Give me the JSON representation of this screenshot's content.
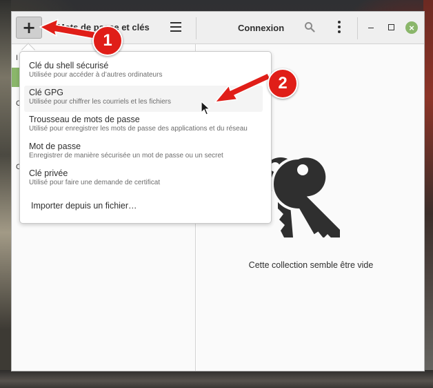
{
  "header": {
    "add_button": "+",
    "app_title": "Mots de passe et clés",
    "connection_title": "Connexion"
  },
  "sidebar": {
    "fragments": [
      "I",
      "C",
      "C"
    ]
  },
  "popover": {
    "items": [
      {
        "title": "Clé du shell sécurisé",
        "subtitle": "Utilisée pour accéder à d’autres ordinateurs"
      },
      {
        "title": "Clé GPG",
        "subtitle": "Utilisée pour chiffrer les courriels et les fichiers"
      },
      {
        "title": "Trousseau de mots de passe",
        "subtitle": "Utilisé pour enregistrer les mots de passe des applications et du réseau"
      },
      {
        "title": "Mot de passe",
        "subtitle": "Enregistrer de manière sécurisée un mot de passe ou un secret"
      },
      {
        "title": "Clé privée",
        "subtitle": "Utilisé pour faire une demande de certificat"
      }
    ],
    "import_label": "Importer depuis un fichier…",
    "hovered_index": 1
  },
  "main": {
    "empty_label": "Cette collection semble être vide"
  },
  "annotations": {
    "badge1": "1",
    "badge2": "2",
    "color": "#e01e18"
  },
  "icons": [
    "plus-icon",
    "hamburger-menu-icon",
    "search-icon",
    "kebab-menu-icon",
    "minimize-icon",
    "maximize-icon",
    "close-icon",
    "keys-icon",
    "mouse-cursor-icon"
  ],
  "colors": {
    "accent": "#8ab66a",
    "header_bg": "#efefef"
  }
}
